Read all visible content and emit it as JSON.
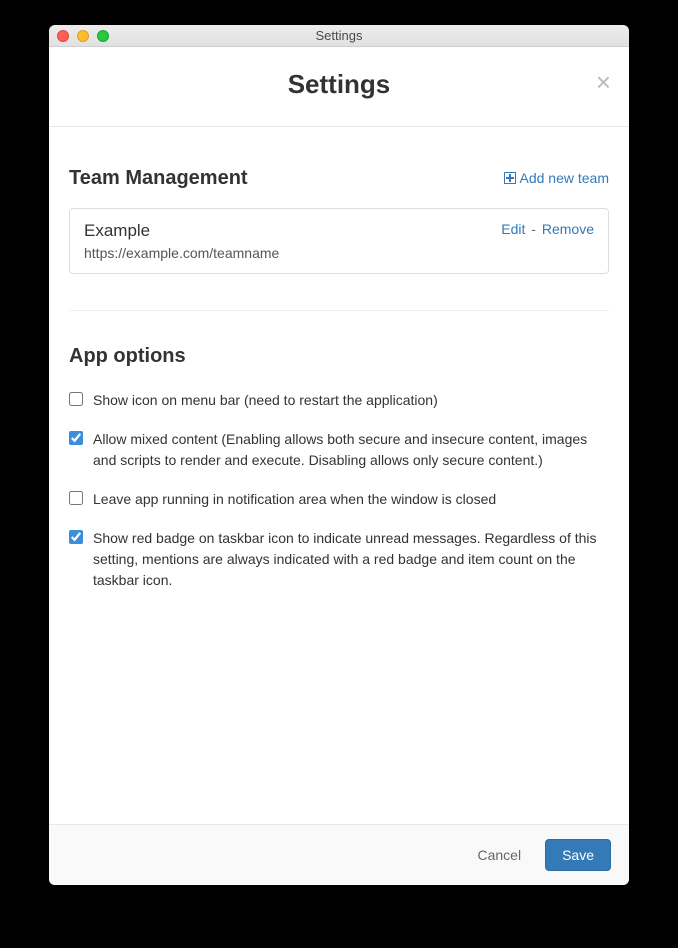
{
  "window": {
    "title": "Settings"
  },
  "header": {
    "title": "Settings"
  },
  "teamManagement": {
    "heading": "Team Management",
    "addNewLabel": "Add new team",
    "team": {
      "name": "Example",
      "url": "https://example.com/teamname",
      "editLabel": "Edit",
      "sep": " - ",
      "removeLabel": "Remove"
    }
  },
  "appOptions": {
    "heading": "App options",
    "items": [
      {
        "checked": false,
        "label": "Show icon on menu bar (need to restart the application)"
      },
      {
        "checked": true,
        "label": "Allow mixed content (Enabling allows both secure and insecure content, images and scripts to render and execute. Disabling allows only secure content.)"
      },
      {
        "checked": false,
        "label": "Leave app running in notification area when the window is closed"
      },
      {
        "checked": true,
        "label": "Show red badge on taskbar icon to indicate unread messages. Regardless of this setting, mentions are always indicated with a red badge and item count on the taskbar icon."
      }
    ]
  },
  "footer": {
    "cancel": "Cancel",
    "save": "Save"
  }
}
